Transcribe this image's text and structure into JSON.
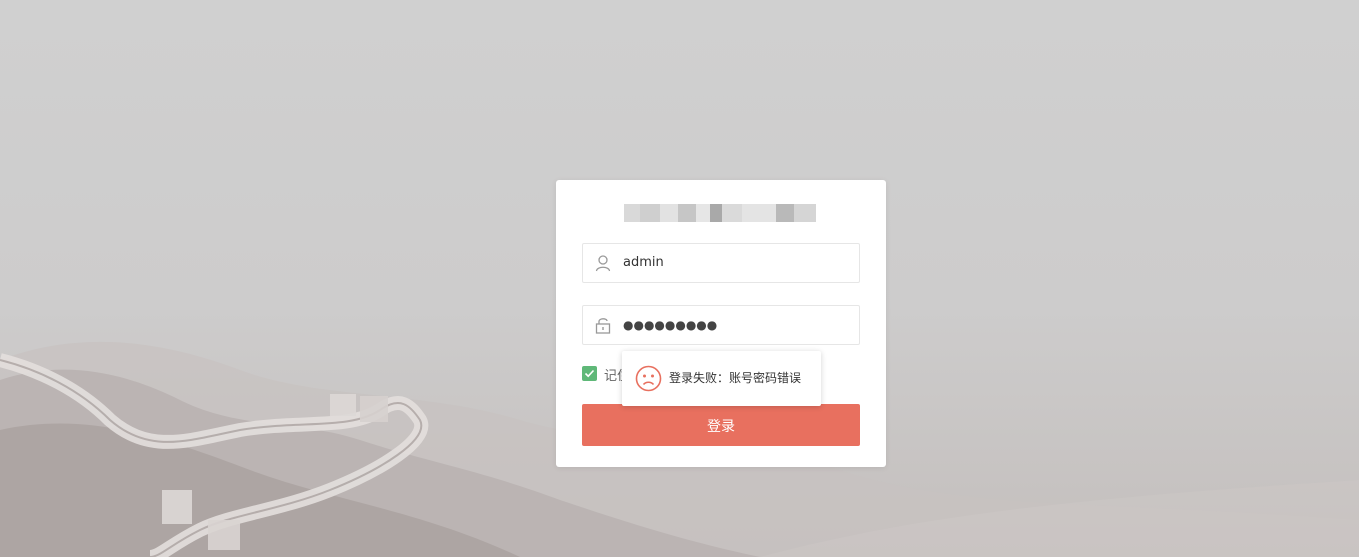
{
  "login": {
    "username_value": "admin",
    "password_value": "●●●●●●●●●",
    "remember_label": "记住",
    "submit_label": "登录"
  },
  "toast": {
    "message": "登录失败：账号密码错误"
  },
  "icons": {
    "username": "user-icon",
    "password": "lock-icon",
    "checkbox": "check-icon",
    "toast": "sad-face-icon"
  },
  "colors": {
    "primary_button": "#e8705f",
    "checkbox": "#5fb878",
    "error_icon": "#e8705f"
  }
}
